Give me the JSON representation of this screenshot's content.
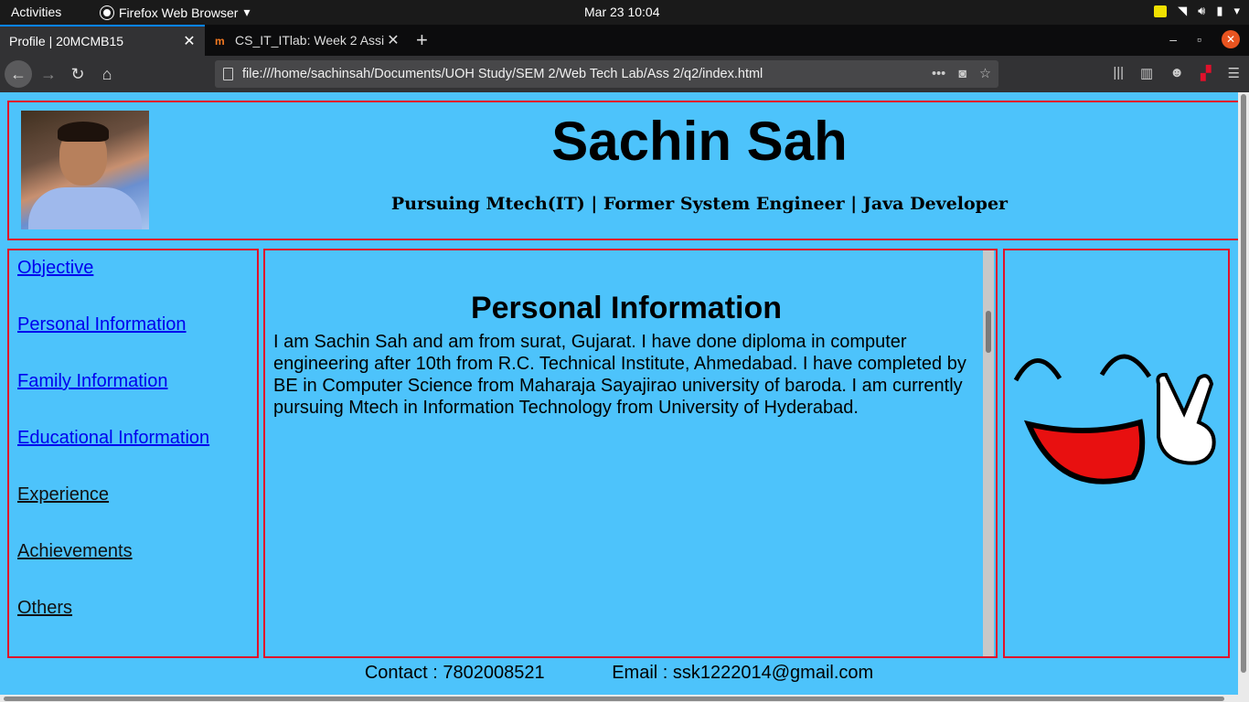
{
  "system": {
    "activities": "Activities",
    "app_name": "Firefox Web Browser",
    "clock": "Mar 23  10:04"
  },
  "browser": {
    "tabs": [
      {
        "title": "Profile | 20MCMB15",
        "active": true
      },
      {
        "title": "CS_IT_ITlab: Week 2 Assi",
        "active": false
      }
    ],
    "url": "file:///home/sachinsah/Documents/UOH Study/SEM 2/Web Tech Lab/Ass 2/q2/index.html"
  },
  "profile": {
    "name": "Sachin Sah",
    "tagline": "Pursuing Mtech(IT) | Former System Engineer | Java Developer"
  },
  "sidebar": {
    "links": [
      {
        "label": "Objective",
        "visited": false
      },
      {
        "label": "Personal Information",
        "visited": false
      },
      {
        "label": "Family Information",
        "visited": false
      },
      {
        "label": "Educational Information",
        "visited": false
      },
      {
        "label": "Experience",
        "visited": true
      },
      {
        "label": "Achievements",
        "visited": true
      },
      {
        "label": "Others",
        "visited": true
      }
    ]
  },
  "main": {
    "heading": "Personal Information",
    "body": "I am Sachin Sah and am from surat, Gujarat. I have done diploma in computer engineering after 10th from R.C. Technical Institute, Ahmedabad. I have completed by BE in Computer Science from Maharaja Sayajirao university of baroda. I am currently pursuing Mtech in Information Technology from University of Hyderabad."
  },
  "footer": {
    "contact": "Contact : 7802008521",
    "email": "Email : ssk1222014@gmail.com"
  },
  "colors": {
    "page_bg": "#4dc3fb",
    "border": "#e0112b",
    "link": "#0000ee"
  }
}
